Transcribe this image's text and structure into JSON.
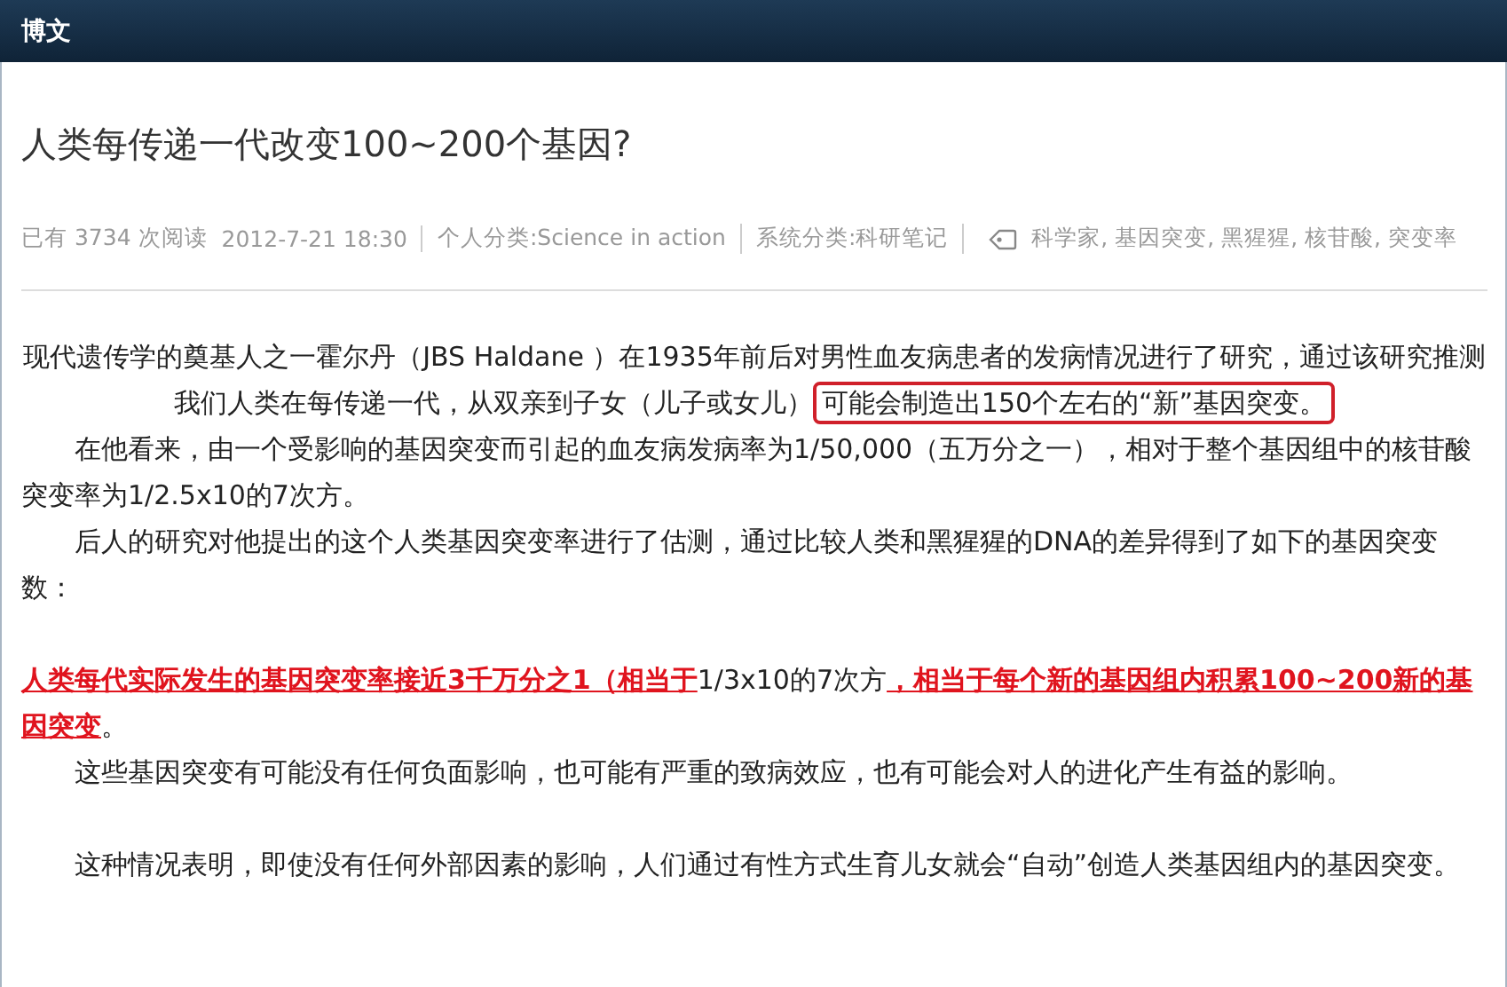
{
  "header": {
    "title": "博文"
  },
  "article": {
    "title": "人类每传递一代改变100~200个基因?",
    "meta": {
      "reads": "已有 3734 次阅读",
      "date": "2012-7-21 18:30",
      "personal_category": "个人分类:Science in action",
      "system_category": "系统分类:科研笔记",
      "tags": "科学家, 基因突变, 黑猩猩, 核苷酸, 突变率"
    },
    "paragraphs": [
      {
        "kind": "centered",
        "segments": [
          {
            "kind": "plain",
            "text": "现代遗传学的奠基人之一霍尔丹（JBS Haldane ）在1935年前后对男性血友病患者的发病情况进行了研究，通过该研究推测我们人类在每传递一代，从双亲到子女（儿子或女儿）"
          },
          {
            "kind": "boxed",
            "text": "可能会制造出150个左右的“新”基因突变。"
          }
        ]
      },
      {
        "kind": "indented",
        "segments": [
          {
            "kind": "plain",
            "text": "在他看来，由一个受影响的基因突变而引起的血友病发病率为1/50,000（五万分之一），相对于整个基因组中的核苷酸突变率为1/2.5x10的7次方。"
          }
        ]
      },
      {
        "kind": "indented",
        "segments": [
          {
            "kind": "plain",
            "text": "后人的研究对他提出的这个人类基因突变率进行了估测，通过比较人类和黑猩猩的DNA的差异得到了如下的基因突变数："
          }
        ]
      },
      {
        "kind": "flush-spaced",
        "segments": [
          {
            "kind": "emphasis",
            "text": "人类每代实际发生的基因突变率接近3千万分之1（相当于"
          },
          {
            "kind": "plain",
            "text": "1/3x10的7次方"
          },
          {
            "kind": "emphasis",
            "text": "，相当于每个新的基因组内积累100~200新的基因突变"
          },
          {
            "kind": "plain",
            "text": "。"
          }
        ]
      },
      {
        "kind": "indented",
        "segments": [
          {
            "kind": "plain",
            "text": "这些基因突变有可能没有任何负面影响，也可能有严重的致病效应，也有可能会对人的进化产生有益的影响。"
          }
        ]
      },
      {
        "kind": "indented-spaced",
        "segments": [
          {
            "kind": "plain",
            "text": "这种情况表明，即使没有任何外部因素的影响，人们通过有性方式生育儿女就会“自动”创造人类基因组内的基因突变。"
          }
        ]
      }
    ]
  }
}
